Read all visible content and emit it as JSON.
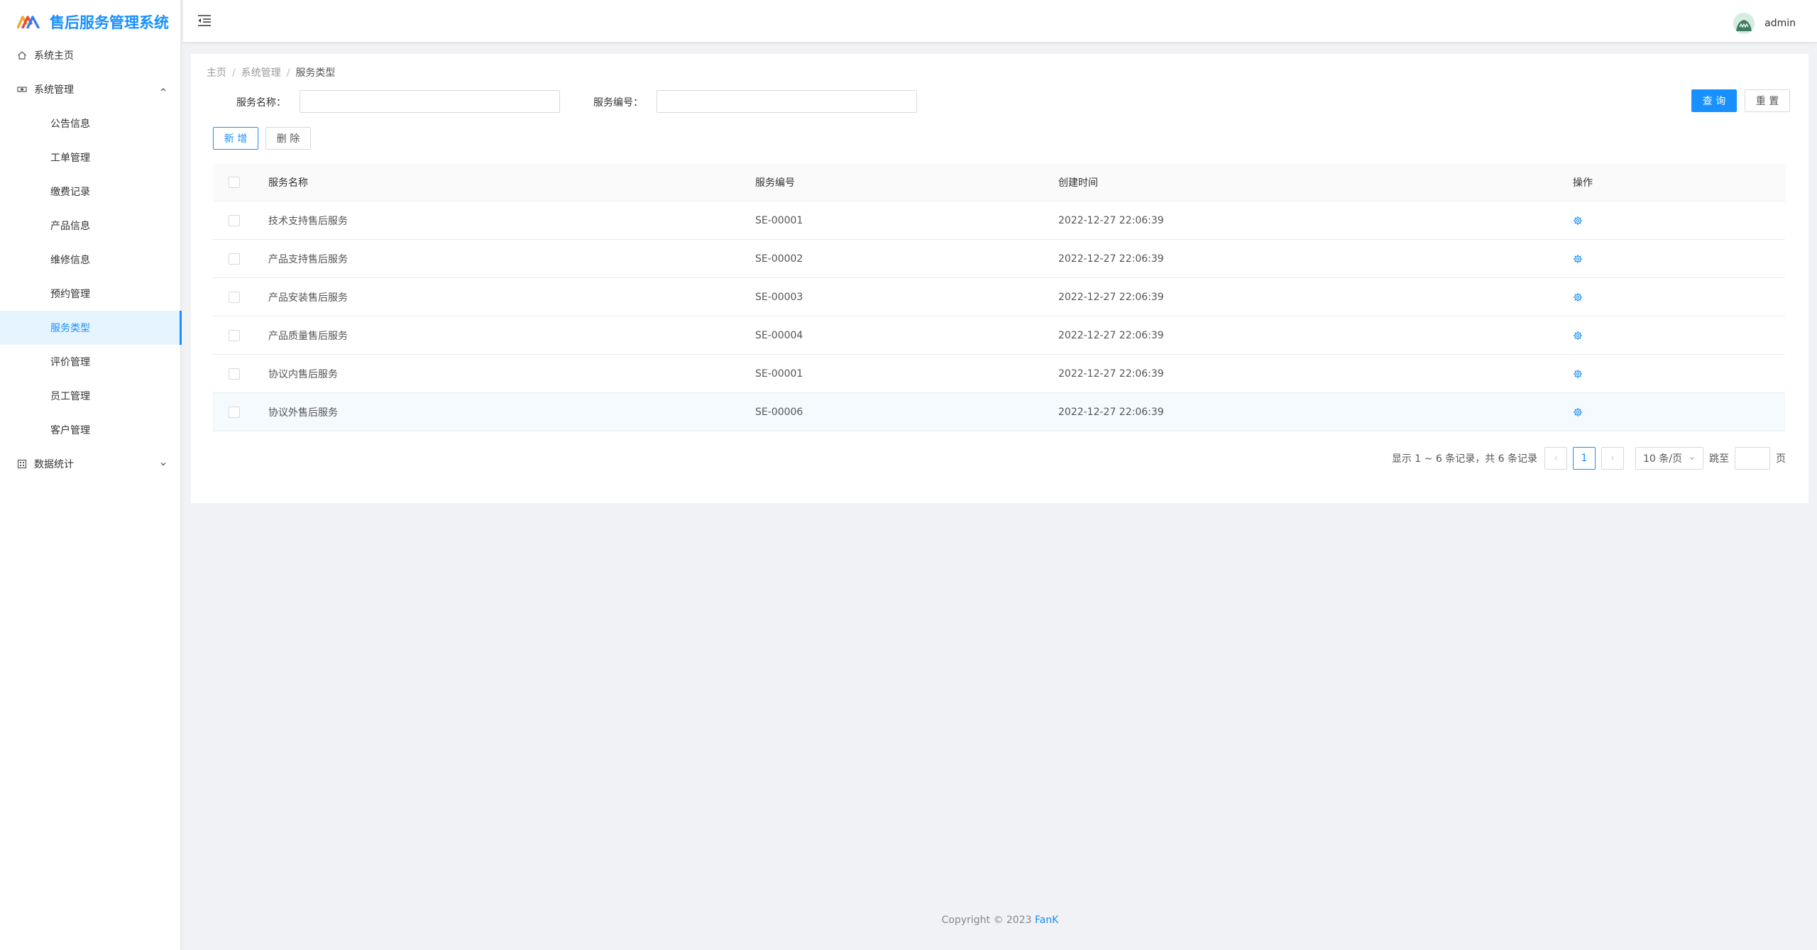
{
  "app": {
    "title": "售后服务管理系统",
    "brand_color": "#1890ff"
  },
  "sidebar": {
    "items": [
      {
        "label": "系统主页",
        "icon": "home-icon"
      },
      {
        "label": "系统管理",
        "icon": "settings-icon",
        "expanded": true
      },
      {
        "label": "公告信息"
      },
      {
        "label": "工单管理"
      },
      {
        "label": "缴费记录"
      },
      {
        "label": "产品信息"
      },
      {
        "label": "维修信息"
      },
      {
        "label": "预约管理"
      },
      {
        "label": "服务类型",
        "active": true
      },
      {
        "label": "评价管理"
      },
      {
        "label": "员工管理"
      },
      {
        "label": "客户管理"
      },
      {
        "label": "数据统计",
        "icon": "chart-icon",
        "expanded": false
      }
    ]
  },
  "header": {
    "username": "admin"
  },
  "breadcrumb": {
    "items": [
      "主页",
      "系统管理",
      "服务类型"
    ],
    "separator": "/"
  },
  "search": {
    "name_label": "服务名称：",
    "name_value": "",
    "code_label": "服务编号：",
    "code_value": "",
    "query_label": "查 询",
    "reset_label": "重 置"
  },
  "toolbar": {
    "add_label": "新 增",
    "delete_label": "删 除"
  },
  "table": {
    "columns": [
      "服务名称",
      "服务编号",
      "创建时间",
      "操作"
    ],
    "rows": [
      {
        "name": "技术支持售后服务",
        "code": "SE-00001",
        "time": "2022-12-27 22:06:39"
      },
      {
        "name": "产品支持售后服务",
        "code": "SE-00002",
        "time": "2022-12-27 22:06:39"
      },
      {
        "name": "产品安装售后服务",
        "code": "SE-00003",
        "time": "2022-12-27 22:06:39"
      },
      {
        "name": "产品质量售后服务",
        "code": "SE-00004",
        "time": "2022-12-27 22:06:39"
      },
      {
        "name": "协议内售后服务",
        "code": "SE-00001",
        "time": "2022-12-27 22:06:39"
      },
      {
        "name": "协议外售后服务",
        "code": "SE-00006",
        "time": "2022-12-27 22:06:39"
      }
    ]
  },
  "pagination": {
    "summary": "显示 1 ~ 6 条记录，共 6 条记录",
    "prev": "‹",
    "current_page": "1",
    "next": "›",
    "page_size": "10 条/页",
    "jump_label": "跳至",
    "jump_unit": "页"
  },
  "footer": {
    "copyright": "Copyright © 2023 ",
    "author": "FanK"
  }
}
